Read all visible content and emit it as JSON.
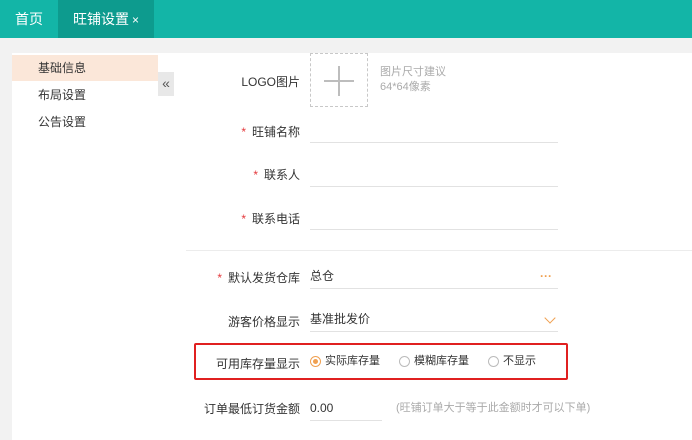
{
  "tabs": {
    "home_label": "首页",
    "active_label": "旺铺设置",
    "close_symbol": "×"
  },
  "sidebar": {
    "items": [
      {
        "label": "基础信息",
        "active": true
      },
      {
        "label": "布局设置",
        "active": false
      },
      {
        "label": "公告设置",
        "active": false
      }
    ],
    "collapse_symbol": "«"
  },
  "form": {
    "logo_label": "LOGO图片",
    "logo_hint_line1": "图片尺寸建议",
    "logo_hint_line2": "64*64像素",
    "required_mark": "*",
    "store_name_label": "旺铺名称",
    "store_name_value": "",
    "contact_label": "联系人",
    "contact_value": "",
    "phone_label": "联系电话",
    "phone_value": "",
    "warehouse_label": "默认发货仓库",
    "warehouse_value": "总仓",
    "warehouse_more": "···",
    "guest_price_label": "游客价格显示",
    "guest_price_value": "基准批发价",
    "stock_display_label": "可用库存量显示",
    "stock_options": [
      "实际库存量",
      "模糊库存量",
      "不显示"
    ],
    "stock_selected": "实际库存量",
    "min_order_label": "订单最低订货金额",
    "min_order_value": "0.00",
    "min_order_hint": "(旺铺订单大于等于此金额时才可以下单)"
  },
  "colors": {
    "brand": "#13b5a7",
    "brand_dark": "#0d9b8e",
    "accent": "#f0a050",
    "required": "#e4393c",
    "highlight_border": "#e02020"
  }
}
